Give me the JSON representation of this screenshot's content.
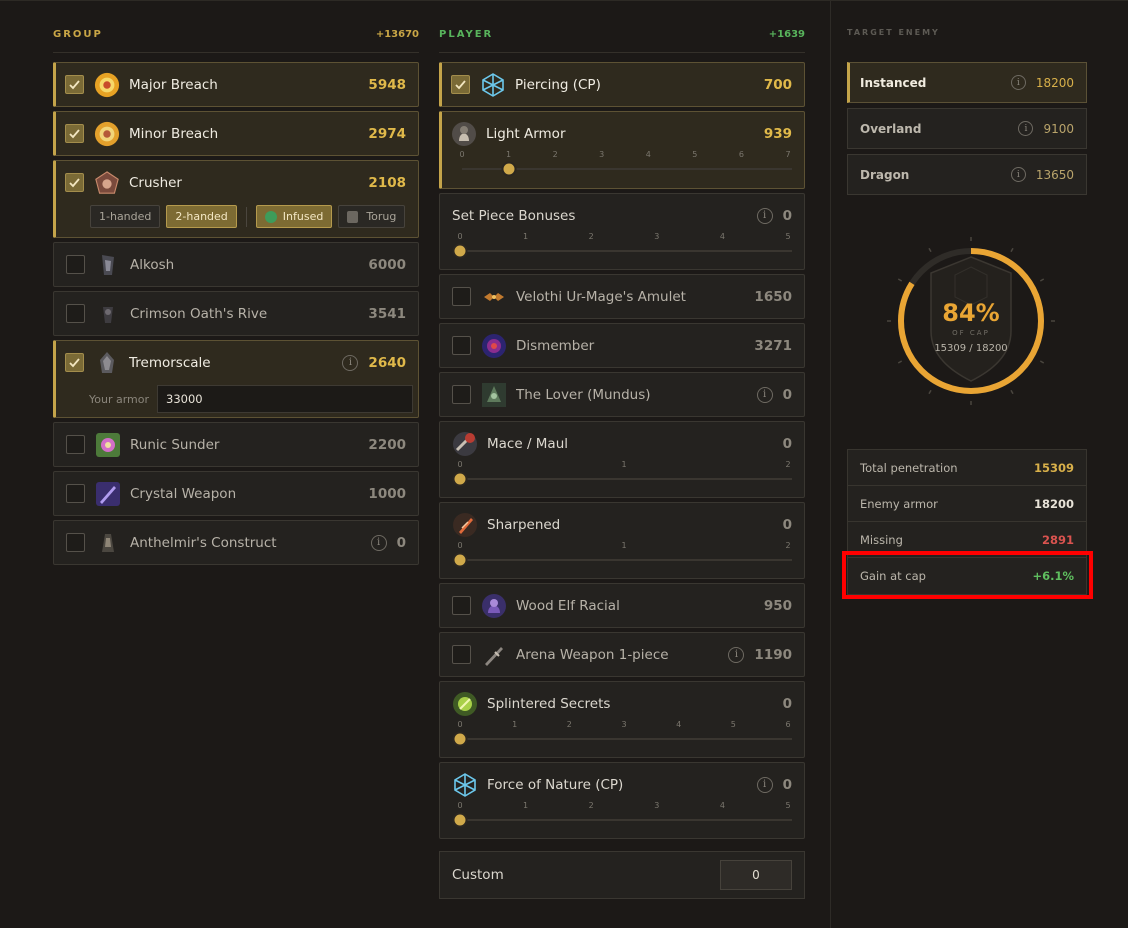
{
  "group": {
    "title": "GROUP",
    "total": "+13670",
    "items": [
      {
        "name": "Major Breach",
        "value": "5948",
        "checked": true
      },
      {
        "name": "Minor Breach",
        "value": "2974",
        "checked": true
      },
      {
        "name": "Crusher",
        "value": "2108",
        "checked": true,
        "options": [
          "1-handed",
          "2-handed"
        ],
        "selected": "2-handed",
        "toggles": [
          "Infused",
          "Torug"
        ],
        "toggle_on": "Infused"
      },
      {
        "name": "Alkosh",
        "value": "6000",
        "checked": false
      },
      {
        "name": "Crimson Oath's Rive",
        "value": "3541",
        "checked": false
      },
      {
        "name": "Tremorscale",
        "value": "2640",
        "checked": true,
        "info": "i",
        "armor_label": "Your armor",
        "armor_value": "33000"
      },
      {
        "name": "Runic Sunder",
        "value": "2200",
        "checked": false
      },
      {
        "name": "Crystal Weapon",
        "value": "1000",
        "checked": false
      },
      {
        "name": "Anthelmir's Construct",
        "value": "0",
        "checked": false,
        "info": "i"
      }
    ]
  },
  "player": {
    "title": "PLAYER",
    "total": "+1639",
    "items": [
      {
        "name": "Piercing (CP)",
        "value": "700",
        "checked": true
      },
      {
        "name": "Light Armor",
        "value": "939",
        "ticks": [
          "0",
          "1",
          "2",
          "3",
          "4",
          "5",
          "6",
          "7"
        ],
        "level": 1
      },
      {
        "name": "Set Piece Bonuses",
        "value": "0",
        "info": "i",
        "ticks": [
          "0",
          "1",
          "2",
          "3",
          "4",
          "5"
        ],
        "level": 0
      },
      {
        "name": "Velothi Ur-Mage's Amulet",
        "value": "1650",
        "checked": false
      },
      {
        "name": "Dismember",
        "value": "3271",
        "checked": false
      },
      {
        "name": "The Lover (Mundus)",
        "value": "0",
        "checked": false,
        "info": "i"
      },
      {
        "name": "Mace / Maul",
        "value": "0",
        "ticks": [
          "0",
          "1",
          "2"
        ],
        "level": 0
      },
      {
        "name": "Sharpened",
        "value": "0",
        "ticks": [
          "0",
          "1",
          "2"
        ],
        "level": 0
      },
      {
        "name": "Wood Elf Racial",
        "value": "950",
        "checked": false
      },
      {
        "name": "Arena Weapon 1-piece",
        "value": "1190",
        "checked": false,
        "info": "i"
      },
      {
        "name": "Splintered Secrets",
        "value": "0",
        "ticks": [
          "0",
          "1",
          "2",
          "3",
          "4",
          "5",
          "6"
        ],
        "level": 0
      },
      {
        "name": "Force of Nature (CP)",
        "value": "0",
        "info": "i",
        "ticks": [
          "0",
          "1",
          "2",
          "3",
          "4",
          "5"
        ],
        "level": 0
      }
    ],
    "custom_label": "Custom",
    "custom_value": "0"
  },
  "target": {
    "title": "TARGET ENEMY",
    "enemies": [
      {
        "name": "Instanced",
        "value": "18200",
        "info": "i",
        "selected": true
      },
      {
        "name": "Overland",
        "value": "9100",
        "info": "i"
      },
      {
        "name": "Dragon",
        "value": "13650",
        "info": "i"
      }
    ],
    "gauge": {
      "percent": "84%",
      "fraction": 0.84,
      "sub": "OF CAP",
      "ratio": "15309 / 18200"
    },
    "stats": [
      {
        "label": "Total penetration",
        "value": "15309",
        "color": "#d8b04a"
      },
      {
        "label": "Enemy armor",
        "value": "18200",
        "color": "#e8e3d8"
      },
      {
        "label": "Missing",
        "value": "2891",
        "color": "#d9534f"
      },
      {
        "label": "Gain at cap",
        "value": "+6.1%",
        "color": "#5fbf5f"
      }
    ]
  },
  "colors": {
    "accent": "#c4a44a",
    "green": "#58b45c",
    "gauge": "#e9a534"
  }
}
